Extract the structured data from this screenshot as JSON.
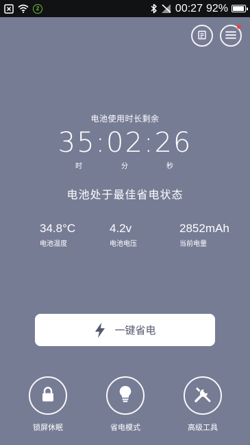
{
  "status_bar": {
    "left_icons": [
      "close-box-icon",
      "wifi-icon",
      "notification-badge-icon"
    ],
    "badge_text": "2",
    "right_icons": [
      "bluetooth-icon",
      "no-signal-icon"
    ],
    "time": "00:27",
    "battery_percent": "92%",
    "battery_level": 0.92
  },
  "top_buttons": {
    "book_icon": "book-icon",
    "book_text": "阅",
    "menu_icon": "hamburger-menu-icon",
    "menu_has_badge": true
  },
  "battery_info": {
    "remaining_label": "电池使用时长剩余",
    "hours": "35",
    "minutes": "02",
    "seconds": "26",
    "separator": ":",
    "unit_hours": "时",
    "unit_minutes": "分",
    "unit_seconds": "秒",
    "state": "电池处于最佳省电状态"
  },
  "stats": {
    "temperature_value": "34.8°C",
    "temperature_label": "电池温度",
    "voltage_value": "4.2v",
    "voltage_label": "电池电压",
    "capacity_value": "2852mAh",
    "capacity_label": "当前电量"
  },
  "actions": {
    "one_click_label": "一键省电",
    "one_click_icon": "lightning-bolt-icon"
  },
  "tools": [
    {
      "label": "锁屏休眠",
      "icon": "padlock-icon"
    },
    {
      "label": "省电模式",
      "icon": "lightbulb-icon"
    },
    {
      "label": "高级工具",
      "icon": "wrench-icon"
    }
  ],
  "colors": {
    "background": "#777c95",
    "status_bar": "#111214",
    "button_text": "#55596c",
    "badge_red": "#e8423f",
    "notification_green": "#6fbf3a"
  }
}
